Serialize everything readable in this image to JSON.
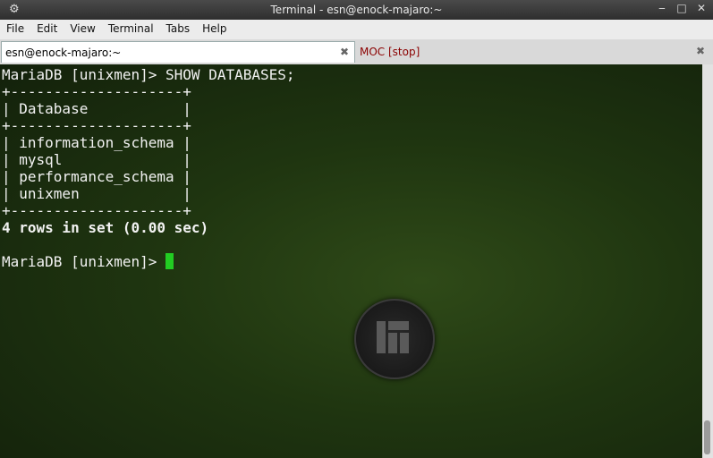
{
  "window": {
    "title": "Terminal - esn@enock-majaro:~"
  },
  "menu": [
    "File",
    "Edit",
    "View",
    "Terminal",
    "Tabs",
    "Help"
  ],
  "tabs": [
    {
      "label": "esn@enock-majaro:~",
      "active": true
    },
    {
      "label": "MOC [stop]",
      "active": false
    }
  ],
  "terminal": {
    "lines": [
      "MariaDB [unixmen]> SHOW DATABASES;",
      "+--------------------+",
      "| Database           |",
      "+--------------------+",
      "| information_schema |",
      "| mysql              |",
      "| performance_schema |",
      "| unixmen            |",
      "+--------------------+",
      "4 rows in set (0.00 sec)",
      "",
      "MariaDB [unixmen]> "
    ]
  },
  "colors": {
    "cursor": "#22cc22",
    "background": "#1f3510"
  },
  "icons": {
    "logo": "manjaro-logo-icon"
  }
}
